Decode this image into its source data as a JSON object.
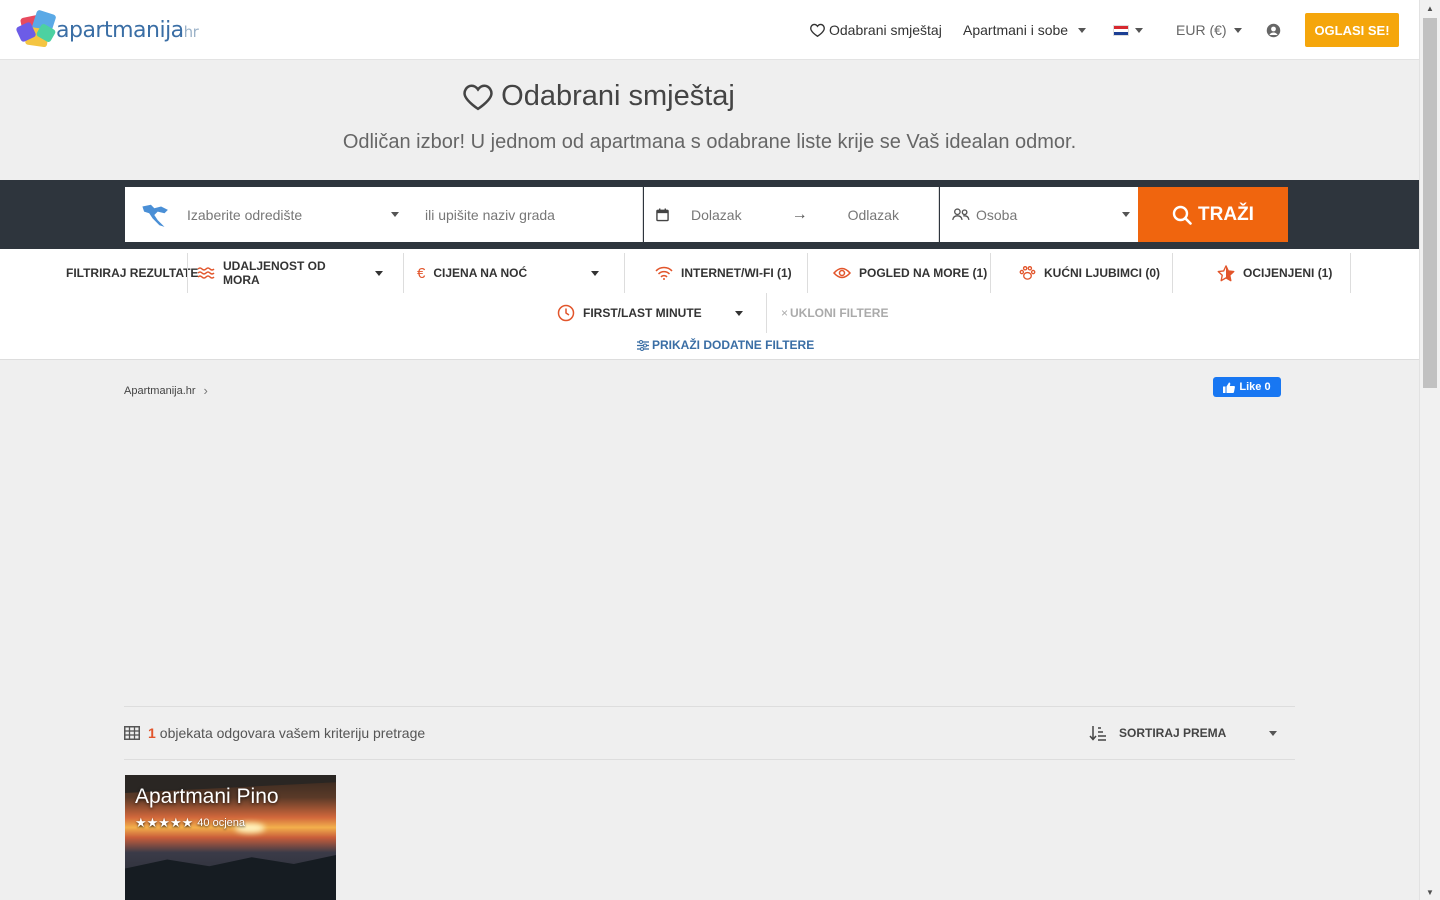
{
  "header": {
    "logo_text": "apartmanija",
    "logo_tld": "hr",
    "favorites_label": "Odabrani smještaj",
    "apartments_label": "Apartmani i sobe",
    "language_flag": "hr-flag-icon",
    "currency_label": "EUR (€)",
    "user_icon": "user-icon",
    "cta_label": "OGLASI SE!",
    "cta_color": "#f5a60b"
  },
  "hero": {
    "title": "Odabrani smještaj",
    "subtitle": "Odličan izbor! U jednom od apartmana s odabrane liste krije se Vaš idealan odmor."
  },
  "search": {
    "destination_placeholder": "Izaberite odredište",
    "city_placeholder": "ili upišite naziv grada",
    "arrival_placeholder": "Dolazak",
    "departure_placeholder": "Odlazak",
    "persons_placeholder": "Osoba",
    "button_label": "TRAŽI",
    "button_color": "#f0650e"
  },
  "filters": {
    "title": "FILTRIRAJ REZULTATE",
    "distance_label": "UDALJENOST OD MORA",
    "price_label": "CIJENA NA NOĆ",
    "internet_label": "INTERNET/WI-FI (1)",
    "seaview_label": "POGLED NA MORE (1)",
    "pets_label": "KUĆNI LJUBIMCI (0)",
    "rated_label": "OCIJENJENI (1)",
    "lastminute_label": "FIRST/LAST MINUTE",
    "remove_label": "UKLONI FILTERE",
    "more_label": "PRIKAŽI DODATNE FILTERE",
    "accent_color": "#e2552b"
  },
  "breadcrumb": {
    "home": "Apartmanija.hr"
  },
  "facebook": {
    "like_label": "Like 0"
  },
  "results": {
    "count": "1",
    "text": "objekata odgovara vašem kriteriju pretrage",
    "sort_label": "SORTIRAJ PREMA"
  },
  "listings": [
    {
      "name": "Apartmani Pino",
      "stars": "★★★★★",
      "reviews": "40 ocjena"
    }
  ]
}
